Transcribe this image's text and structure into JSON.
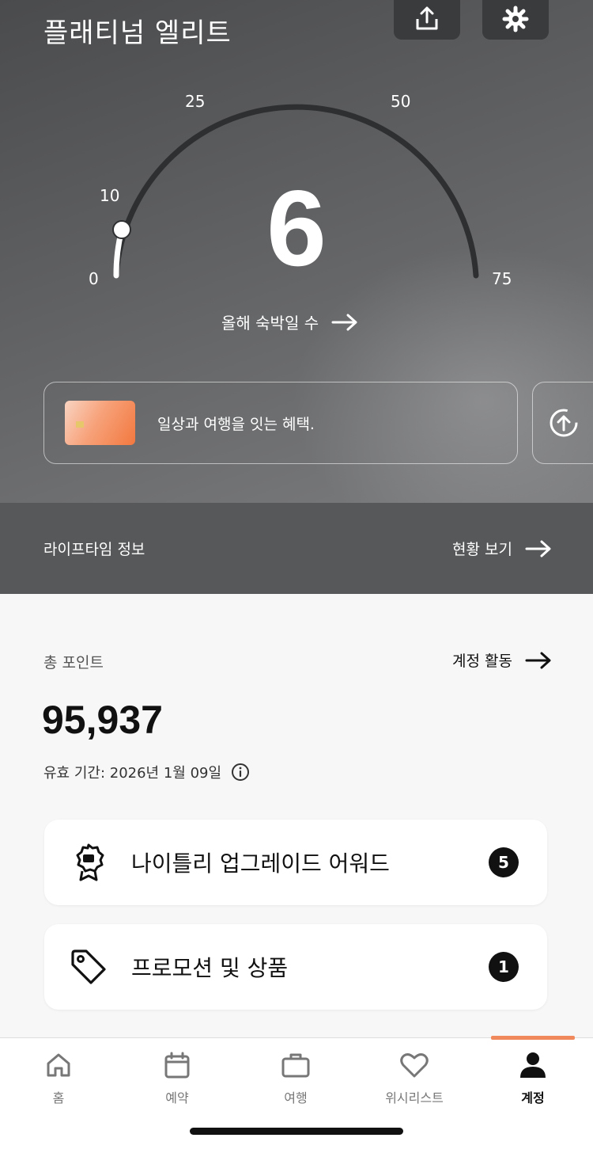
{
  "header": {
    "tier_title": "플래티넘 엘리트"
  },
  "gauge": {
    "scale_labels": [
      "0",
      "10",
      "25",
      "50",
      "75"
    ],
    "min": 0,
    "max": 75,
    "current": 6,
    "nights_value": "6",
    "nights_label": "올해 숙박일 수"
  },
  "card_banner": {
    "text": "일상과 여행을 잇는 혜택."
  },
  "lifetime": {
    "label": "라이프타임 정보",
    "link": "현황 보기"
  },
  "points": {
    "label": "총 포인트",
    "activity_link": "계정 활동",
    "value": "95,937",
    "expiry": "유효 기간: 2026년 1월 09일"
  },
  "list": [
    {
      "label": "나이틀리 업그레이드 어워드",
      "count": "5",
      "icon": "award-badge-icon"
    },
    {
      "label": "프로모션 및 상품",
      "count": "1",
      "icon": "tag-icon"
    }
  ],
  "tabs": [
    {
      "label": "홈",
      "icon": "home-icon"
    },
    {
      "label": "예약",
      "icon": "calendar-icon"
    },
    {
      "label": "여행",
      "icon": "suitcase-icon"
    },
    {
      "label": "위시리스트",
      "icon": "heart-icon"
    },
    {
      "label": "계정",
      "icon": "person-icon",
      "active": true
    }
  ],
  "colors": {
    "hero_bg": "#5b5c5e",
    "accent": "#f08a5d",
    "badge": "#111111"
  }
}
